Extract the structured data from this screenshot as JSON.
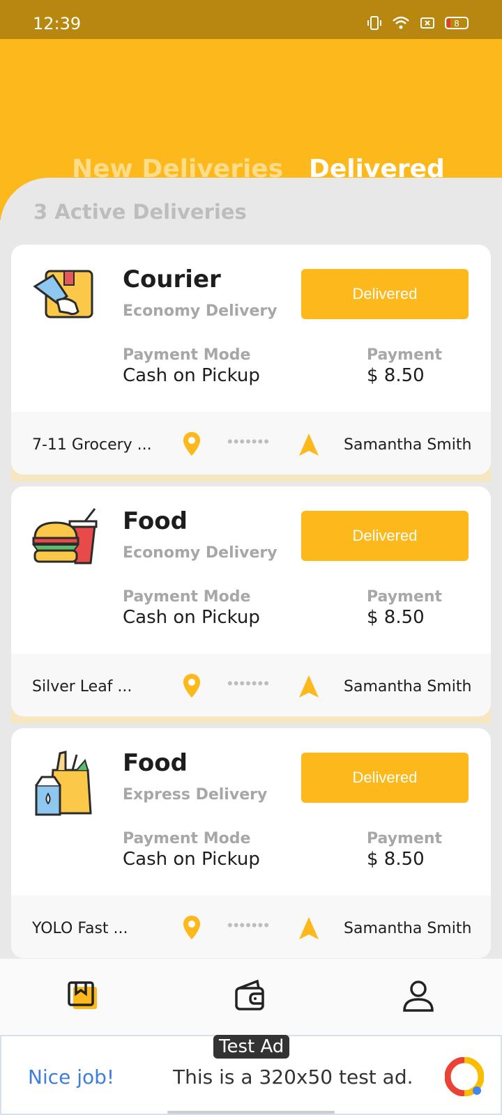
{
  "status_bar": {
    "time": "12:39",
    "battery": "8"
  },
  "tabs": {
    "new_label": "New Deliveries",
    "delivered_label": "Delivered"
  },
  "active_count": "3 Active Deliveries",
  "cards": [
    {
      "title": "Courier",
      "subtitle": "Economy Delivery",
      "button": "Delivered",
      "payment_mode_label": "Payment Mode",
      "payment_mode_value": "Cash on Pickup",
      "payment_label": "Payment",
      "payment_value": "$ 8.50",
      "from": "7-11 Grocery ...",
      "dots": "•••••••",
      "to": "Samantha Smith",
      "icon": "courier-package-icon"
    },
    {
      "title": "Food",
      "subtitle": "Economy Delivery",
      "button": "Delivered",
      "payment_mode_label": "Payment Mode",
      "payment_mode_value": "Cash on Pickup",
      "payment_label": "Payment",
      "payment_value": "$ 8.50",
      "from": "Silver Leaf ...",
      "dots": "•••••••",
      "to": "Samantha Smith",
      "icon": "burger-drink-icon"
    },
    {
      "title": "Food",
      "subtitle": "Express Delivery",
      "button": "Delivered",
      "payment_mode_label": "Payment Mode",
      "payment_mode_value": "Cash on Pickup",
      "payment_label": "Payment",
      "payment_value": "$ 8.50",
      "from": "YOLO Fast ...",
      "dots": "•••••••",
      "to": "Samantha Smith",
      "icon": "grocery-bag-icon"
    }
  ],
  "bottom_nav": [
    "deliveries-icon",
    "wallet-icon",
    "profile-icon"
  ],
  "ad": {
    "tag": "Test Ad",
    "left_text": "Nice job!",
    "text": "This is a 320x50 test ad."
  },
  "colors": {
    "accent": "#fdb81b",
    "status_bar": "#b8870f",
    "text_dark": "#1d1d1d",
    "text_muted": "#a7a7a7"
  }
}
